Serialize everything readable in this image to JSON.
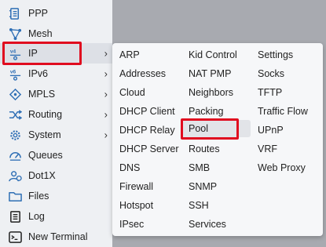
{
  "sidebar": {
    "items": [
      {
        "label": "PPP",
        "icon": "ppp-icon"
      },
      {
        "label": "Mesh",
        "icon": "mesh-icon"
      },
      {
        "label": "IP",
        "icon": "ip-icon",
        "has_submenu": true
      },
      {
        "label": "IPv6",
        "icon": "ipv6-icon",
        "has_submenu": true
      },
      {
        "label": "MPLS",
        "icon": "mpls-icon",
        "has_submenu": true
      },
      {
        "label": "Routing",
        "icon": "routing-icon",
        "has_submenu": true
      },
      {
        "label": "System",
        "icon": "system-gear-icon",
        "has_submenu": true
      },
      {
        "label": "Queues",
        "icon": "queues-icon"
      },
      {
        "label": "Dot1X",
        "icon": "dot1x-icon"
      },
      {
        "label": "Files",
        "icon": "folder-icon"
      },
      {
        "label": "Log",
        "icon": "log-icon"
      },
      {
        "label": "New Terminal",
        "icon": "terminal-icon"
      }
    ],
    "arrow_glyph": "›"
  },
  "ip_submenu": {
    "columns": [
      [
        "ARP",
        "Addresses",
        "Cloud",
        "DHCP Client",
        "DHCP Relay",
        "DHCP Server",
        "DNS",
        "Firewall",
        "Hotspot",
        "IPsec"
      ],
      [
        "Kid Control",
        "NAT PMP",
        "Neighbors",
        "Packing",
        "Pool",
        "Routes",
        "SMB",
        "SNMP",
        "SSH",
        "Services"
      ],
      [
        "Settings",
        "Socks",
        "TFTP",
        "Traffic Flow",
        "UPnP",
        "VRF",
        "Web Proxy"
      ]
    ]
  },
  "colors": {
    "highlight": "#e00c1f",
    "sidebar_bg": "#eef0f3",
    "menu_bg": "#f6f7f9",
    "overlay_bg": "#a8aab0"
  }
}
